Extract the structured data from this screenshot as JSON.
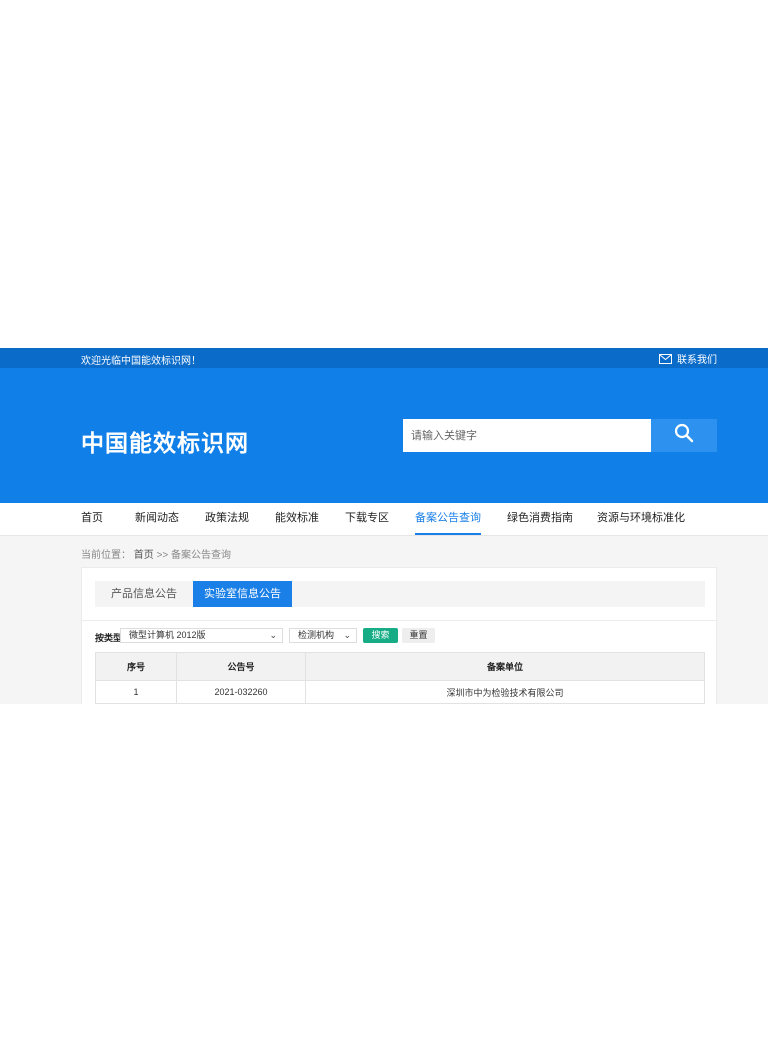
{
  "topbar": {
    "welcome": "欢迎光临中国能效标识网！",
    "contact_label": "联系我们",
    "contact_icon": "mail-icon"
  },
  "header": {
    "logo_text": "中国能效标识网",
    "search_placeholder": "请输入关键字",
    "search_icon": "search-icon"
  },
  "nav": {
    "items": [
      {
        "label": "首页"
      },
      {
        "label": "新闻动态"
      },
      {
        "label": "政策法规"
      },
      {
        "label": "能效标准"
      },
      {
        "label": "下载专区"
      },
      {
        "label": "备案公告查询",
        "active": true
      },
      {
        "label": "绿色消费指南"
      },
      {
        "label": "资源与环境标准化"
      }
    ]
  },
  "breadcrumb": {
    "prefix": "当前位置：",
    "home": "首页",
    "separator": ">>",
    "current": "备案公告查询"
  },
  "tabs": [
    {
      "label": "产品信息公告"
    },
    {
      "label": "实验室信息公告",
      "active": true
    }
  ],
  "filters": {
    "label": "按类型",
    "product_type_value": "微型计算机 2012版",
    "org_value": "检测机构",
    "search_button": "搜索",
    "reset_button": "重置"
  },
  "table": {
    "headers": [
      "序号",
      "公告号",
      "备案单位"
    ],
    "rows": [
      [
        "1",
        "2021-032260",
        "深圳市中为检验技术有限公司"
      ]
    ]
  },
  "colors": {
    "brand_blue": "#1080e8",
    "topbar_blue": "#0a6bc9",
    "active_blue": "#1a7fe6",
    "search_green": "#16ad86"
  }
}
